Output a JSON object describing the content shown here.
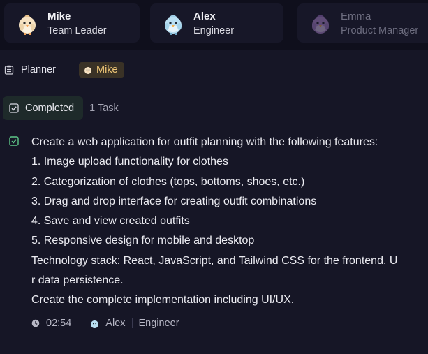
{
  "agents": [
    {
      "name": "Mike",
      "role": "Team Leader",
      "avatar": "chick-avatar-icon"
    },
    {
      "name": "Alex",
      "role": "Engineer",
      "avatar": "blue-bird-avatar-icon"
    },
    {
      "name": "Emma",
      "role": "Product Manager",
      "avatar": "purple-bird-avatar-icon"
    }
  ],
  "planner": {
    "label": "Planner",
    "assignee": "Mike",
    "icon": "clipboard-icon"
  },
  "tabs": {
    "completed_label": "Completed",
    "task_count": "1 Task"
  },
  "task": {
    "lines": [
      "Create a web application for outfit planning with the following features:",
      "1. Image upload functionality for clothes",
      "2. Categorization of clothes (tops, bottoms, shoes, etc.)",
      "3. Drag and drop interface for creating outfit combinations",
      "4. Save and view created outfits",
      "5. Responsive design for mobile and desktop",
      "Technology stack: React, JavaScript, and Tailwind CSS for the frontend. U",
      "r data persistence.",
      "Create the complete implementation including UI/UX."
    ],
    "time": "02:54",
    "agent": "Alex",
    "agent_role": "Engineer"
  },
  "colors": {
    "background": "#161626",
    "header": "#0f0f1c",
    "check_green": "#5fc98a",
    "chip_text": "#f0c777"
  }
}
